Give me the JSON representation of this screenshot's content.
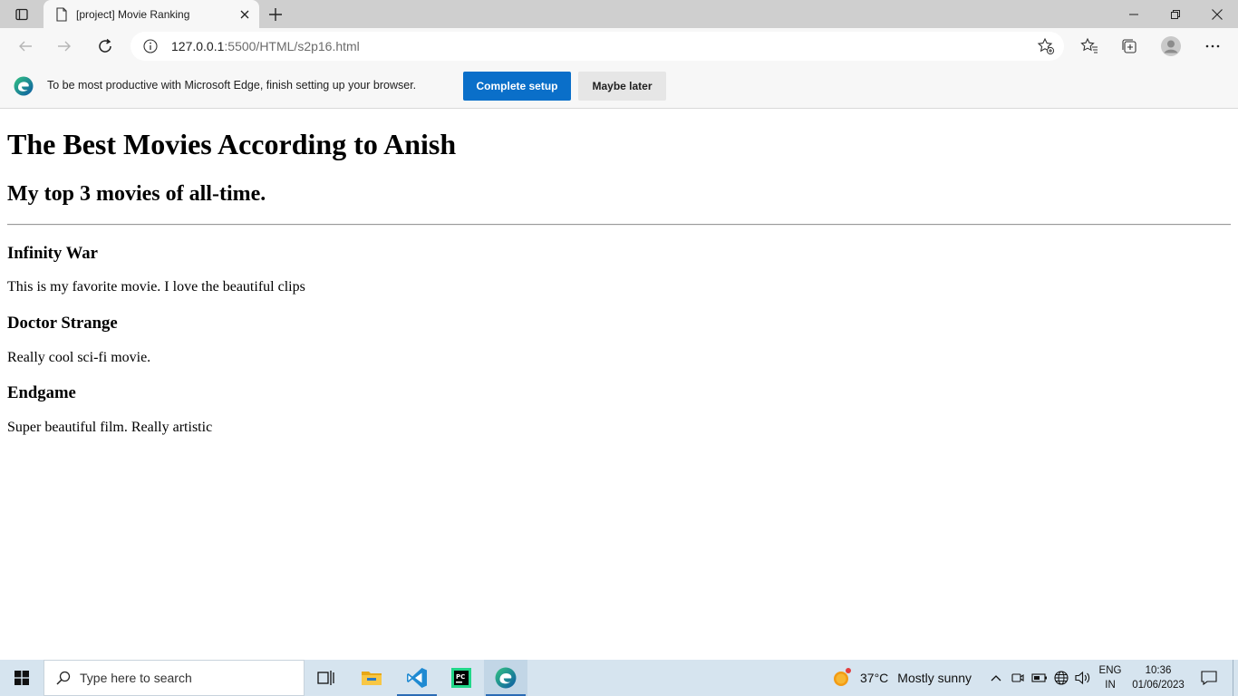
{
  "browser": {
    "tab": {
      "title": "[project] Movie Ranking"
    },
    "url": {
      "host": "127.0.0.1",
      "path": ":5500/HTML/s2p16.html"
    }
  },
  "infobar": {
    "message": "To be most productive with Microsoft Edge, finish setting up your browser.",
    "primary_button": "Complete setup",
    "secondary_button": "Maybe later"
  },
  "page": {
    "title": "The Best Movies According to Anish",
    "subtitle": "My top 3 movies of all-time.",
    "movies": [
      {
        "name": "Infinity War",
        "description": "This is my favorite movie. I love the beautiful clips"
      },
      {
        "name": "Doctor Strange",
        "description": "Really cool sci-fi movie."
      },
      {
        "name": "Endgame",
        "description": "Super beautiful film. Really artistic"
      }
    ]
  },
  "taskbar": {
    "search_placeholder": "Type here to search",
    "weather": {
      "temp": "37°C",
      "condition": "Mostly sunny"
    },
    "language": {
      "line1": "ENG",
      "line2": "IN"
    },
    "clock": {
      "time": "10:36",
      "date": "01/06/2023"
    }
  },
  "colors": {
    "accent": "#0a6fc9",
    "tabstrip": "#cfcfcf",
    "toolbar": "#f7f7f7",
    "taskbar": "#d6e4ef"
  }
}
